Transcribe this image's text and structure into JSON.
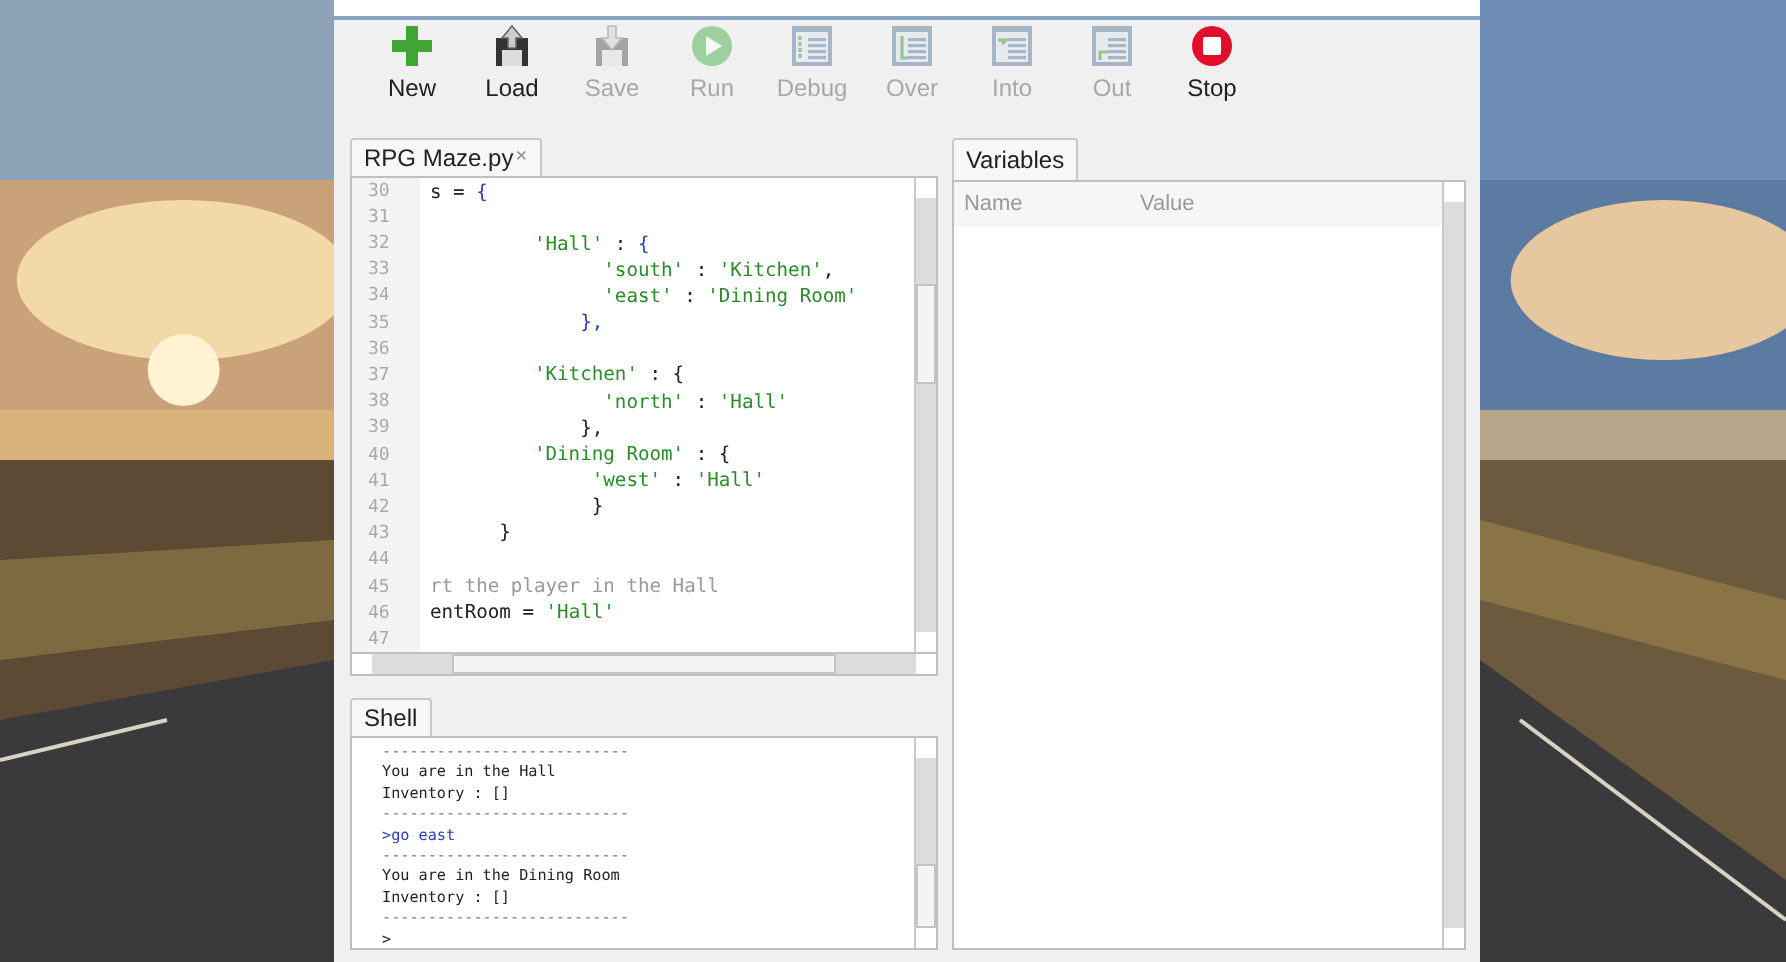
{
  "toolbar": {
    "buttons": [
      {
        "label": "New",
        "kind": "new",
        "disabled": false
      },
      {
        "label": "Load",
        "kind": "load",
        "disabled": false
      },
      {
        "label": "Save",
        "kind": "save",
        "disabled": true
      },
      {
        "label": "Run",
        "kind": "run",
        "disabled": true
      },
      {
        "label": "Debug",
        "kind": "debug",
        "disabled": true
      },
      {
        "label": "Over",
        "kind": "over",
        "disabled": true
      },
      {
        "label": "Into",
        "kind": "into",
        "disabled": true
      },
      {
        "label": "Out",
        "kind": "out",
        "disabled": true
      },
      {
        "label": "Stop",
        "kind": "stop",
        "disabled": false
      }
    ]
  },
  "editor": {
    "tab": {
      "title": "RPG Maze.py",
      "close": "×",
      "selected": true
    },
    "lines": [
      {
        "number": "30",
        "segments": [
          {
            "text": "s = ",
            "kind": "plain"
          },
          {
            "text": "{",
            "kind": "brace"
          }
        ]
      },
      {
        "number": "31"
      },
      {
        "number": "32",
        "segments": [
          {
            "text": "         'Hall'",
            "kind": "string"
          },
          {
            "text": " : ",
            "kind": "plain"
          },
          {
            "text": "{",
            "kind": "brace"
          }
        ]
      },
      {
        "number": "33",
        "segments": [
          {
            "text": "               'south'",
            "kind": "string"
          },
          {
            "text": " : ",
            "kind": "plain"
          },
          {
            "text": "'Kitchen'",
            "kind": "string"
          },
          {
            "text": ",",
            "kind": "plain"
          }
        ]
      },
      {
        "number": "34",
        "segments": [
          {
            "text": "               'east'",
            "kind": "string"
          },
          {
            "text": " : ",
            "kind": "plain"
          },
          {
            "text": "'Dining Room'",
            "kind": "string"
          }
        ]
      },
      {
        "number": "35",
        "segments": [
          {
            "text": "             },",
            "kind": "brace"
          }
        ]
      },
      {
        "number": "36"
      },
      {
        "number": "37",
        "segments": [
          {
            "text": "         'Kitchen'",
            "kind": "string"
          },
          {
            "text": " : {",
            "kind": "plain"
          }
        ]
      },
      {
        "number": "38",
        "segments": [
          {
            "text": "               'north'",
            "kind": "string"
          },
          {
            "text": " : ",
            "kind": "plain"
          },
          {
            "text": "'Hall'",
            "kind": "string"
          }
        ]
      },
      {
        "number": "39",
        "segments": [
          {
            "text": "             },",
            "kind": "plain"
          }
        ]
      },
      {
        "number": "40",
        "segments": [
          {
            "text": "         'Dining Room'",
            "kind": "string"
          },
          {
            "text": " : {",
            "kind": "plain"
          }
        ]
      },
      {
        "number": "41",
        "segments": [
          {
            "text": "              'west'",
            "kind": "string"
          },
          {
            "text": " : ",
            "kind": "plain"
          },
          {
            "text": "'Hall'",
            "kind": "string"
          }
        ]
      },
      {
        "number": "42",
        "segments": [
          {
            "text": "              }",
            "kind": "plain"
          }
        ]
      },
      {
        "number": "43",
        "segments": [
          {
            "text": "      }",
            "kind": "plain"
          }
        ]
      },
      {
        "number": "44"
      },
      {
        "number": "45",
        "segments": [
          {
            "text": "rt the player in the Hall",
            "kind": "comment"
          }
        ]
      },
      {
        "number": "46",
        "segments": [
          {
            "text": "entRoom = ",
            "kind": "plain"
          },
          {
            "text": "'Hall'",
            "kind": "string"
          }
        ]
      },
      {
        "number": "47"
      }
    ]
  },
  "shell": {
    "tab": {
      "title": "Shell",
      "selected": true
    },
    "lines": [
      {
        "text": "---------------------------",
        "kind": "separator"
      },
      {
        "text": "You are in the Hall",
        "kind": "output"
      },
      {
        "text": "Inventory : []",
        "kind": "output"
      },
      {
        "text": "---------------------------",
        "kind": "separator"
      },
      {
        "text": ">go east",
        "kind": "input"
      },
      {
        "text": "---------------------------",
        "kind": "separator"
      },
      {
        "text": "You are in the Dining Room",
        "kind": "output"
      },
      {
        "text": "Inventory : []",
        "kind": "output"
      },
      {
        "text": "---------------------------",
        "kind": "separator"
      },
      {
        "text": ">",
        "kind": "prompt"
      }
    ]
  },
  "variables": {
    "tab": {
      "title": "Variables",
      "selected": true
    },
    "columns": [
      "Name",
      "Value"
    ]
  }
}
